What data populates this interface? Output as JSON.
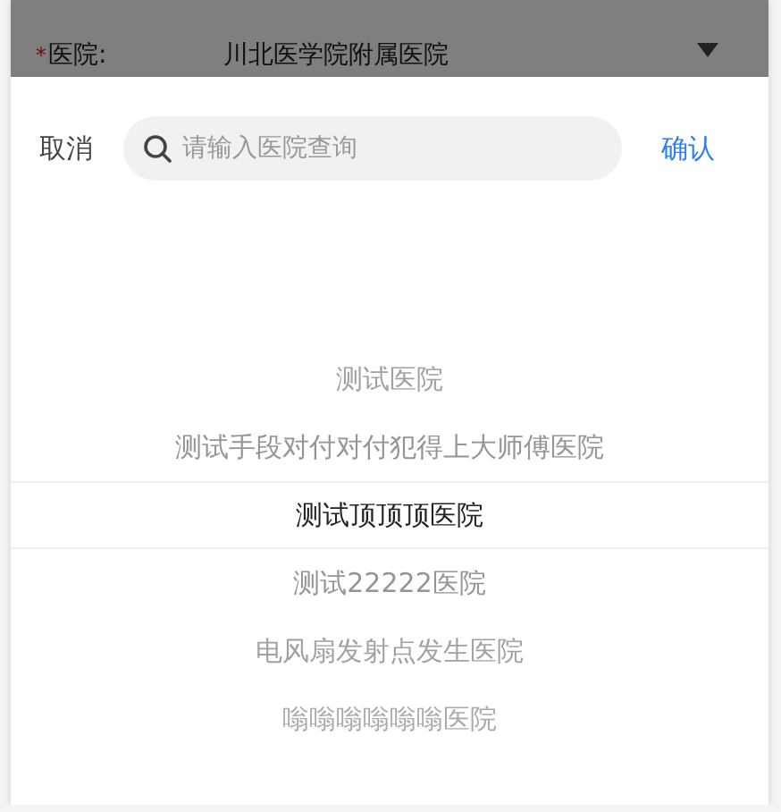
{
  "form": {
    "required_mark": "*",
    "label": "医院:",
    "value": "川北医学院附属医院"
  },
  "picker": {
    "cancel": "取消",
    "confirm": "确认",
    "search": {
      "placeholder": "请输入医院查询"
    },
    "options": [
      {
        "label": "测试医院",
        "selected": false
      },
      {
        "label": "测试手段对付对付犯得上大师傅医院",
        "selected": false
      },
      {
        "label": "测试顶顶顶医院",
        "selected": true
      },
      {
        "label": "测试22222医院",
        "selected": false
      },
      {
        "label": "电风扇发射点发生医院",
        "selected": false
      },
      {
        "label": "嗡嗡嗡嗡嗡嗡医院",
        "selected": false
      }
    ]
  }
}
